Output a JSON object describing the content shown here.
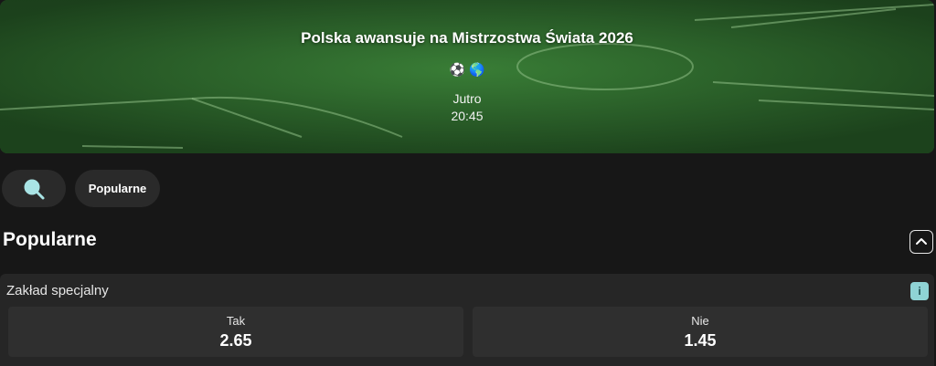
{
  "event": {
    "title": "Polska awansuje na Mistrzostwa Świata 2026",
    "icons": [
      "soccer-ball-icon",
      "globe-icon"
    ],
    "day": "Jutro",
    "time": "20:45"
  },
  "filters": {
    "search_icon": "search-icon",
    "items": [
      {
        "label": "Popularne"
      }
    ]
  },
  "section": {
    "title": "Popularne",
    "collapse_icon": "chevron-up-icon"
  },
  "market": {
    "title": "Zakład specjalny",
    "info_label": "i",
    "outcomes": [
      {
        "label": "Tak",
        "odds": "2.65"
      },
      {
        "label": "Nie",
        "odds": "1.45"
      }
    ]
  },
  "colors": {
    "background": "#171717",
    "card": "#262626",
    "odds_button": "#2f2f2f",
    "pill": "#2a2a2a",
    "accent": "#8fd3d5",
    "pitch_green": "#2f6f2d"
  }
}
